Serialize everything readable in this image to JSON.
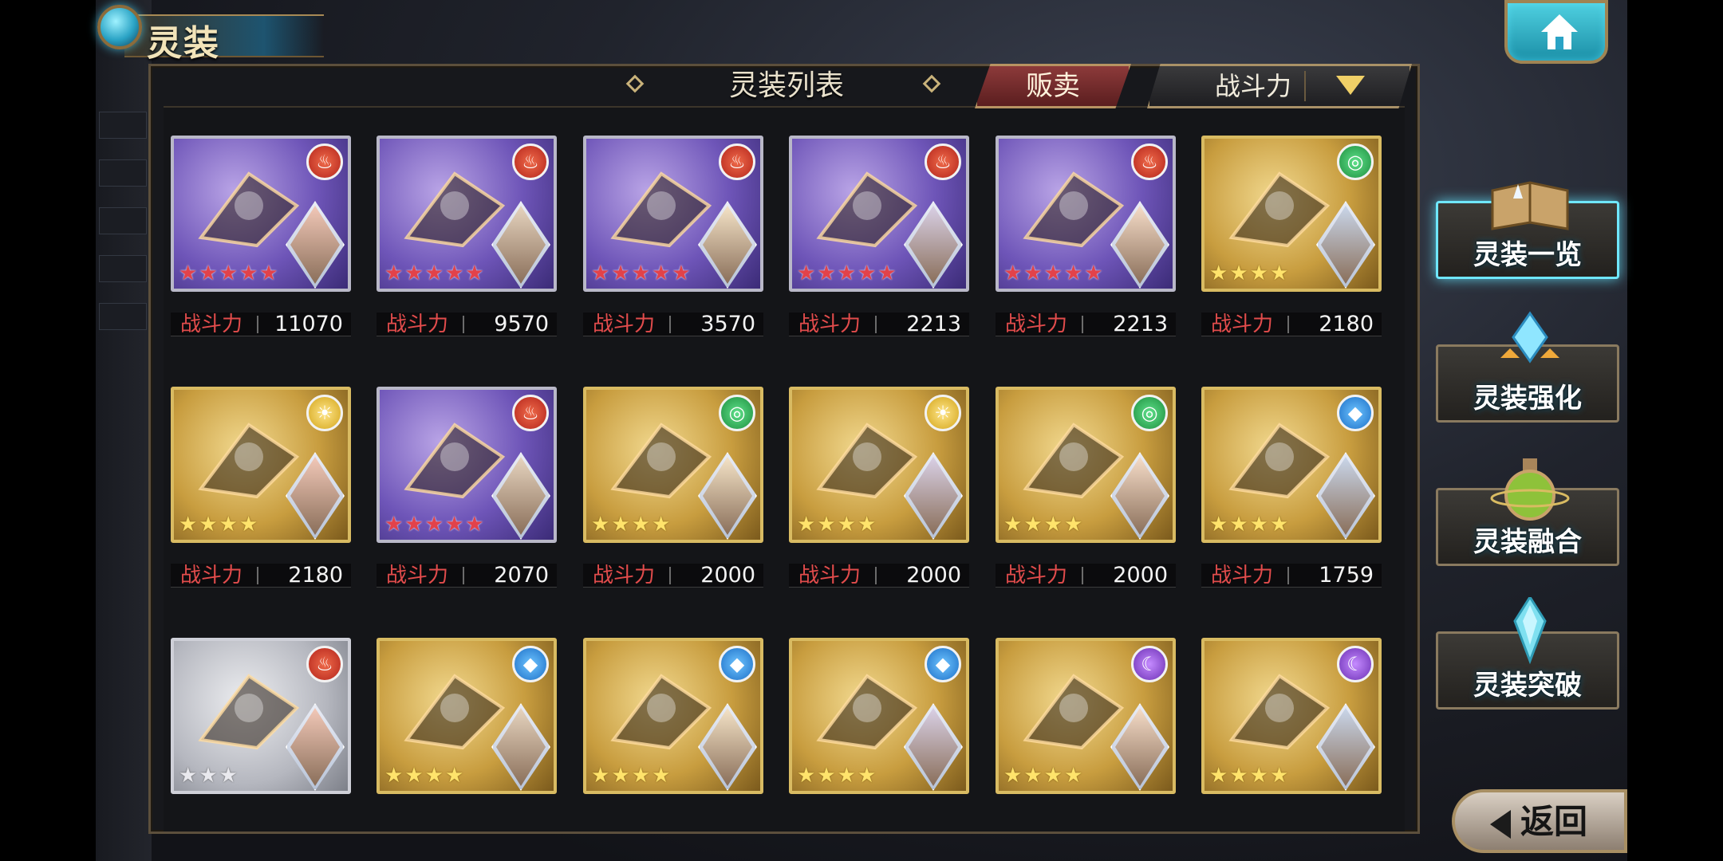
{
  "header": {
    "screen_title": "灵装",
    "list_title": "灵装列表",
    "sell_label": "贩卖",
    "sort_label": "战斗力"
  },
  "power_label": "战斗力",
  "cards": [
    {
      "frame": "purple",
      "attribute": "fire",
      "stars": 5,
      "star_color": "red",
      "item_icon": "claw-weapon-icon",
      "power": "11070"
    },
    {
      "frame": "purple",
      "attribute": "fire",
      "stars": 5,
      "star_color": "red",
      "item_icon": "claw-weapon-icon",
      "power": "9570"
    },
    {
      "frame": "purple",
      "attribute": "fire",
      "stars": 5,
      "star_color": "red",
      "item_icon": "rose-bouquet-icon",
      "power": "3570"
    },
    {
      "frame": "purple",
      "attribute": "fire",
      "stars": 5,
      "star_color": "red",
      "item_icon": "red-flower-orb-icon",
      "power": "2213"
    },
    {
      "frame": "purple",
      "attribute": "fire",
      "stars": 5,
      "star_color": "red",
      "item_icon": "gold-blade-icon",
      "power": "2213"
    },
    {
      "frame": "gold",
      "attribute": "wind",
      "stars": 4,
      "star_color": "gold",
      "item_icon": "winged-knuckle-icon",
      "power": "2180"
    },
    {
      "frame": "gold",
      "attribute": "light",
      "stars": 4,
      "star_color": "gold",
      "item_icon": "silver-bow-icon",
      "power": "2180"
    },
    {
      "frame": "purple",
      "attribute": "fire",
      "stars": 5,
      "star_color": "red",
      "item_icon": "rose-bouquet-icon",
      "power": "2070"
    },
    {
      "frame": "gold",
      "attribute": "wind",
      "stars": 4,
      "star_color": "gold",
      "item_icon": "green-scythe-icon",
      "power": "2000"
    },
    {
      "frame": "gold",
      "attribute": "light",
      "stars": 4,
      "star_color": "gold",
      "item_icon": "silver-bow-icon",
      "power": "2000"
    },
    {
      "frame": "gold",
      "attribute": "wind",
      "stars": 4,
      "star_color": "gold",
      "item_icon": "black-bow-icon",
      "power": "2000"
    },
    {
      "frame": "gold",
      "attribute": "water",
      "stars": 4,
      "star_color": "gold",
      "item_icon": "blue-gun-icon",
      "power": "1759"
    },
    {
      "frame": "silver",
      "attribute": "fire",
      "stars": 3,
      "star_color": "silver",
      "item_icon": "feather-orb-icon",
      "power": null
    },
    {
      "frame": "gold",
      "attribute": "water",
      "stars": 4,
      "star_color": "gold",
      "item_icon": "scroll-icon",
      "power": null
    },
    {
      "frame": "gold",
      "attribute": "water",
      "stars": 4,
      "star_color": "gold",
      "item_icon": "scroll-icon",
      "power": null
    },
    {
      "frame": "gold",
      "attribute": "water",
      "stars": 4,
      "star_color": "gold",
      "item_icon": "scroll-icon",
      "power": null
    },
    {
      "frame": "gold",
      "attribute": "dark",
      "stars": 4,
      "star_color": "gold",
      "item_icon": "purple-flower-icon",
      "power": null
    },
    {
      "frame": "gold",
      "attribute": "dark",
      "stars": 4,
      "star_color": "gold",
      "item_icon": "purple-flower-icon",
      "power": null
    }
  ],
  "side_menu": [
    {
      "label": "灵装一览",
      "icon": "open-book-icon",
      "active": true
    },
    {
      "label": "灵装强化",
      "icon": "crystal-upgrade-icon",
      "active": false
    },
    {
      "label": "灵装融合",
      "icon": "potion-flask-icon",
      "active": false
    },
    {
      "label": "灵装突破",
      "icon": "crystal-shard-icon",
      "active": false
    }
  ],
  "back_label": "返回",
  "colors": {
    "accent_cyan": "#6fe7ff",
    "power_label_red": "#e24c4c",
    "sell_red": "#8c3a3a",
    "frame_gold": "#d9bb62"
  }
}
